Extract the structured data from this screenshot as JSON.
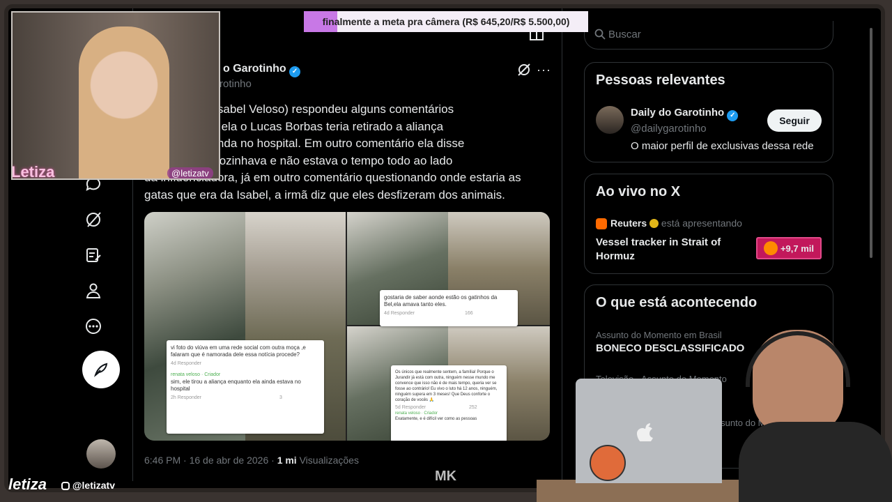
{
  "overlay": {
    "goal_text": "finalmente a meta pra câmera (R$ 645,20/R$ 5.500,00)",
    "goal_progress": 0.117
  },
  "streamer": {
    "name": "Letiza",
    "handle": "@letizatv",
    "bottom_logo": "letiza",
    "bottom_handle": "@letizatv"
  },
  "watermark": "MK",
  "post": {
    "author_name": "o Garotinho",
    "author_handle": "rotinho",
    "text": "oso (Irmã da Isabel Veloso) respondeu alguns comentários\nado, Segundo ela o Lucas Borbas teria retirado a aliança\nabel estava ainda no hospital. Em outro comentário ela disse\nda irmã nem cozinhava e não estava o tempo todo ao lado\nda influenciadora, já em outro comentário questionando onde estaria as\ngatas que era da Isabel, a irmã diz que eles desfizeram dos animais.",
    "timestamp": "6:46 PM · 16 de abr de 2026 ·",
    "views_count": "1 mi",
    "views_label": "Visualizações",
    "comments": [
      {
        "text": "vi foto do viúva em uma rede social com outra moça ,e falaram que é namorada dele essa notícia procede?",
        "meta": "4d    Responder",
        "reply_author": "renata veloso · Criador",
        "reply_text": "sim, ele tirou a aliança enquanto ela ainda estava no hospital",
        "reply_meta": "2h    Responder",
        "reply_likes": "3"
      },
      {
        "text": "gostaria de saber aonde estão os gatinhos da Bel,ela amava tanto eles.",
        "meta": "4d    Responder",
        "likes": "166"
      },
      {
        "text": "Os únicos que realmente sentem, a família! Porque o Jurandir já está com outra, ninguém nesse mundo me convence que isso não é de mais tempo, queria ver se fosse ao contrário! Eu vivo o luto há 12 anos, ninguém, ninguém supera em 3 meses! Que Deus conforte o coração de vocês 🙏",
        "meta": "5d    Responder",
        "likes": "252",
        "reply_author": "renata veloso · Criador",
        "reply_text": "Exatamente, e é difícil ver como as pessoas"
      }
    ]
  },
  "sidebar": {
    "search_placeholder": "Buscar",
    "relevant": {
      "title": "Pessoas relevantes",
      "name": "Daily do Garotinho",
      "handle": "@dailygarotinho",
      "bio": "O maior perfil de exclusivas dessa rede",
      "follow_label": "Seguir"
    },
    "live": {
      "title": "Ao vivo no X",
      "host": "Reuters",
      "host_suffix": "está apresentando",
      "headline": "Vessel tracker in Strait of Hormuz",
      "listeners": "+9,7 mil"
    },
    "trends": {
      "title": "O que está acontecendo",
      "items": [
        {
          "context": "Assunto do Momento em Brasil",
          "name": "BONECO DESCLASSIFICADO"
        },
        {
          "context": "Televisão · Assunto do Momento",
          "name": ""
        },
        {
          "context": "Assunto do Momen",
          "name": ""
        }
      ]
    }
  },
  "colors": {
    "background": "#000000",
    "accent": "#1d9bf0",
    "overlay_fill": "#c878e6",
    "live_badge": "#c2185b"
  }
}
